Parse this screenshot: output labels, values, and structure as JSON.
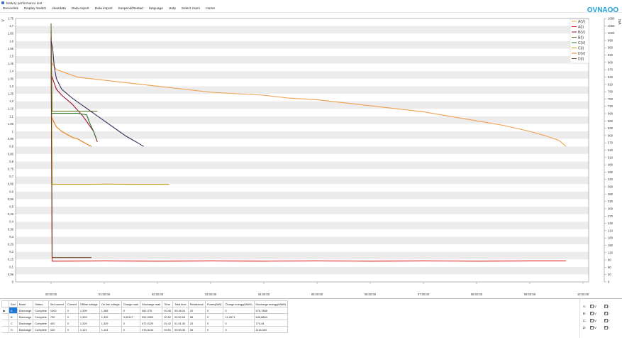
{
  "window": {
    "title": "Battery performance test"
  },
  "menu": [
    "Devicelink",
    "Display Switch",
    "cleardata",
    "Data export",
    "Data import",
    "Suspend/Restart",
    "language",
    "Help",
    "Select zoom",
    "Home"
  ],
  "logo_text": "OVNAOO",
  "chart_data": {
    "type": "line",
    "x_unit": "time (hh:mm:ss)",
    "x_ticks": [
      "00:00:00",
      "01:00:00",
      "02:00:00",
      "03:00:00",
      "04:00:00",
      "05:00:00",
      "06:00:00",
      "07:00:00",
      "08:00:00",
      "09:00:00",
      "10:00:00"
    ],
    "x_range_hours": [
      0,
      10
    ],
    "ylabel_left": "V",
    "ylabel_right": "mA",
    "left_axis": {
      "min": 0,
      "max": 1.75,
      "step": 0.05
    },
    "right_axis": {
      "min": 0,
      "max": 1080,
      "step": 30
    },
    "y_ticks_left": [
      "0",
      "0,05",
      "0,1",
      "0,15",
      "0,2",
      "0,25",
      "0,3",
      "0,35",
      "0,4",
      "0,45",
      "0,5",
      "0,55",
      "0,6",
      "0,65",
      "0,7",
      "0,75",
      "0,8",
      "0,85",
      "0,9",
      "0,95",
      "1",
      "1,05",
      "1,1",
      "1,15",
      "1,2",
      "1,25",
      "1,3",
      "1,35",
      "1,4",
      "1,45",
      "1,5",
      "1,55",
      "1,6",
      "1,65",
      "1,7",
      "1,75"
    ],
    "y_ticks_right": [
      "0",
      "30",
      "60",
      "90",
      "120",
      "150",
      "180",
      "210",
      "240",
      "270",
      "300",
      "330",
      "360",
      "390",
      "420",
      "450",
      "480",
      "510",
      "540",
      "570",
      "600",
      "630",
      "660",
      "690",
      "720",
      "750",
      "780",
      "810",
      "840",
      "870",
      "900",
      "930",
      "960",
      "990",
      "1020",
      "1050",
      "1080"
    ],
    "grid": true,
    "legend_position": "top-right",
    "series": [
      {
        "name": "A(V)",
        "color": "#f0a050",
        "axis": "left",
        "points": [
          [
            0.0,
            1.46
          ],
          [
            0.1,
            1.41
          ],
          [
            0.5,
            1.36
          ],
          [
            1.0,
            1.34
          ],
          [
            1.5,
            1.32
          ],
          [
            2.0,
            1.3
          ],
          [
            2.5,
            1.28
          ],
          [
            3.0,
            1.26
          ],
          [
            3.5,
            1.25
          ],
          [
            4.0,
            1.24
          ],
          [
            4.5,
            1.22
          ],
          [
            5.0,
            1.21
          ],
          [
            5.5,
            1.19
          ],
          [
            6.0,
            1.17
          ],
          [
            6.5,
            1.15
          ],
          [
            7.0,
            1.13
          ],
          [
            7.5,
            1.1
          ],
          [
            8.0,
            1.07
          ],
          [
            8.5,
            1.04
          ],
          [
            9.0,
            1.0
          ],
          [
            9.3,
            0.97
          ],
          [
            9.55,
            0.94
          ],
          [
            9.68,
            0.9
          ]
        ]
      },
      {
        "name": "A(I)",
        "color": "#e02020",
        "axis": "right",
        "points": [
          [
            0.0,
            1030
          ],
          [
            0.02,
            85
          ],
          [
            1.0,
            86
          ],
          [
            2.0,
            85
          ],
          [
            3.0,
            86
          ],
          [
            4.0,
            85
          ],
          [
            5.0,
            86
          ],
          [
            6.0,
            85
          ],
          [
            7.0,
            86
          ],
          [
            8.0,
            85
          ],
          [
            9.0,
            86
          ],
          [
            9.68,
            86
          ]
        ]
      },
      {
        "name": "B(V)",
        "color": "#a01030",
        "axis": "left",
        "points": [
          [
            0.0,
            1.38
          ],
          [
            0.1,
            1.28
          ],
          [
            0.2,
            1.24
          ],
          [
            0.3,
            1.21
          ],
          [
            0.4,
            1.18
          ],
          [
            0.5,
            1.14
          ],
          [
            0.6,
            1.1
          ],
          [
            0.7,
            1.05
          ],
          [
            0.8,
            1.0
          ],
          [
            0.85,
            0.95
          ],
          [
            0.87,
            0.93
          ]
        ]
      },
      {
        "name": "B(I)",
        "color": "#5c7a2a",
        "axis": "right",
        "points": [
          [
            0.0,
            1060
          ],
          [
            0.02,
            700
          ],
          [
            0.87,
            700
          ]
        ]
      },
      {
        "name": "C(V)",
        "color": "#2e7a2e",
        "axis": "left",
        "points": [
          [
            0.0,
            1.11
          ],
          [
            0.02,
            1.12
          ],
          [
            0.3,
            1.12
          ],
          [
            0.5,
            1.12
          ],
          [
            0.67,
            1.11
          ],
          [
            0.72,
            1.06
          ],
          [
            0.8,
            1.0
          ],
          [
            0.85,
            0.95
          ]
        ]
      },
      {
        "name": "C(I)",
        "color": "#c8a020",
        "axis": "right",
        "points": [
          [
            0.0,
            1000
          ],
          [
            0.02,
            400
          ],
          [
            0.7,
            400
          ],
          [
            1.0,
            401
          ],
          [
            1.5,
            400
          ],
          [
            2.0,
            400
          ],
          [
            2.22,
            400
          ]
        ]
      },
      {
        "name": "D(V)",
        "color": "#e87a10",
        "axis": "left",
        "points": [
          [
            0.0,
            1.1
          ],
          [
            0.1,
            1.03
          ],
          [
            0.2,
            1.0
          ],
          [
            0.3,
            0.98
          ],
          [
            0.4,
            0.96
          ],
          [
            0.5,
            0.95
          ],
          [
            0.6,
            0.93
          ],
          [
            0.7,
            0.91
          ],
          [
            0.76,
            0.9
          ]
        ]
      },
      {
        "name": "D(I)",
        "color": "#6a4020",
        "axis": "right",
        "points": [
          [
            0.0,
            1000
          ],
          [
            0.02,
            100
          ],
          [
            0.76,
            100
          ]
        ]
      },
      {
        "name": "",
        "color": "#3a2a5a",
        "axis": "left",
        "points": [
          [
            0.0,
            1.6
          ],
          [
            0.03,
            1.55
          ],
          [
            0.06,
            1.43
          ],
          [
            0.1,
            1.35
          ],
          [
            0.2,
            1.28
          ],
          [
            0.4,
            1.22
          ],
          [
            0.6,
            1.17
          ],
          [
            0.8,
            1.12
          ],
          [
            1.0,
            1.07
          ],
          [
            1.2,
            1.02
          ],
          [
            1.4,
            0.97
          ],
          [
            1.6,
            0.93
          ],
          [
            1.74,
            0.9
          ]
        ]
      }
    ]
  },
  "table": {
    "headers": [
      "Slot",
      "Mode",
      "Status",
      "Set current",
      "Current",
      "Offline voltage",
      "On line voltage",
      "Charge mah",
      "Discharge mah",
      "Time",
      "Total time",
      "Resistance",
      "Power(MW)",
      "Charge energy(MWH)",
      "Discharge energy(MWH)"
    ],
    "rows": [
      [
        "A",
        "Discharge",
        "Complete",
        "1000",
        "0",
        "1,399",
        "1,368",
        "0",
        "562,375",
        "00:46",
        "00:46:24",
        "20",
        "0",
        "0",
        "576,7888"
      ],
      [
        "B",
        "Discharge",
        "Complete",
        "700",
        "0",
        "1,353",
        "1,392",
        "3,05127",
        "591,5309",
        "00:52",
        "00:52:06",
        "58",
        "0",
        "11,2671",
        "645,8884"
      ],
      [
        "C",
        "Discharge",
        "Complete",
        "400",
        "0",
        "1,329",
        "1,329",
        "0",
        "672,0229",
        "01:42",
        "01:41:30",
        "23",
        "0",
        "0",
        "774,44"
      ],
      [
        "D",
        "Discharge",
        "Complete",
        "100",
        "0",
        "1,113",
        "1,113",
        "0",
        "976,5414",
        "09:51",
        "09:50:30",
        "28",
        "0",
        "0",
        "1116,322"
      ]
    ],
    "selected_row_marker": "▶"
  },
  "slot_checks": [
    {
      "label": "A:",
      "v": "V",
      "i": "I"
    },
    {
      "label": "B:",
      "v": "V",
      "i": "I"
    },
    {
      "label": "C:",
      "v": "V",
      "i": "I"
    },
    {
      "label": "D:",
      "v": "V",
      "i": "I"
    }
  ]
}
